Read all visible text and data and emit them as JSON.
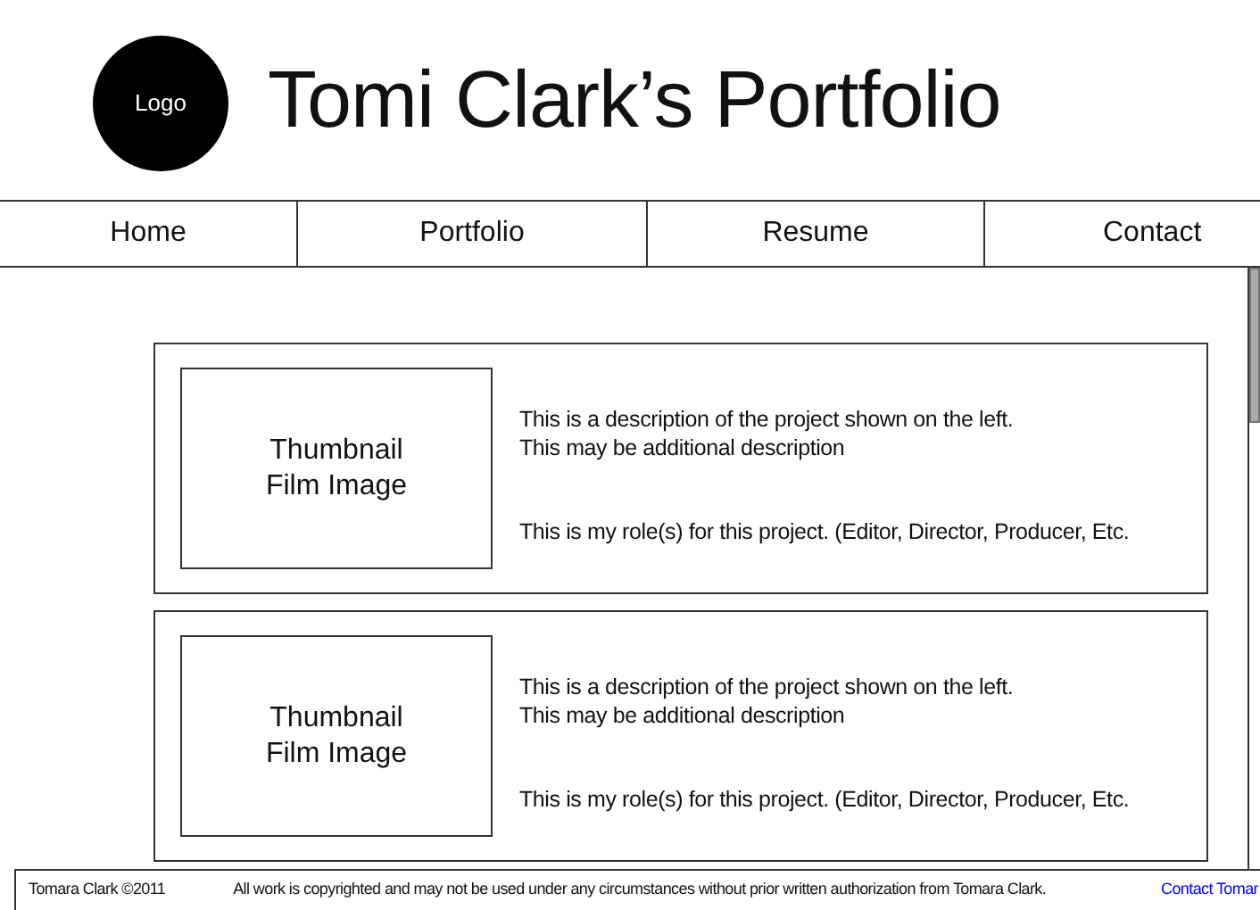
{
  "header": {
    "logo": "Logo",
    "title": "Tomi Clark’s Portfolio"
  },
  "nav": [
    {
      "label": "Home"
    },
    {
      "label": "Portfolio"
    },
    {
      "label": "Resume"
    },
    {
      "label": "Contact"
    }
  ],
  "projects": [
    {
      "thumbnail": [
        "Thumbnail",
        "Film Image"
      ],
      "description": [
        "This is a description of the project shown on the left.",
        "This may be additional description"
      ],
      "role": "This is my role(s) for this project. (Editor, Director, Producer, Etc."
    },
    {
      "thumbnail": [
        "Thumbnail",
        "Film Image"
      ],
      "description": [
        "This is a description of the project shown on the left.",
        "This may be additional description"
      ],
      "role": "This is my role(s) for this project. (Editor, Director, Producer, Etc."
    }
  ],
  "footer": {
    "copyright": "Tomara Clark ©2011",
    "notice": "All work is copyrighted and may not be used under any circumstances without prior written authorization from Tomara Clark.",
    "link": "Contact Tomar"
  }
}
